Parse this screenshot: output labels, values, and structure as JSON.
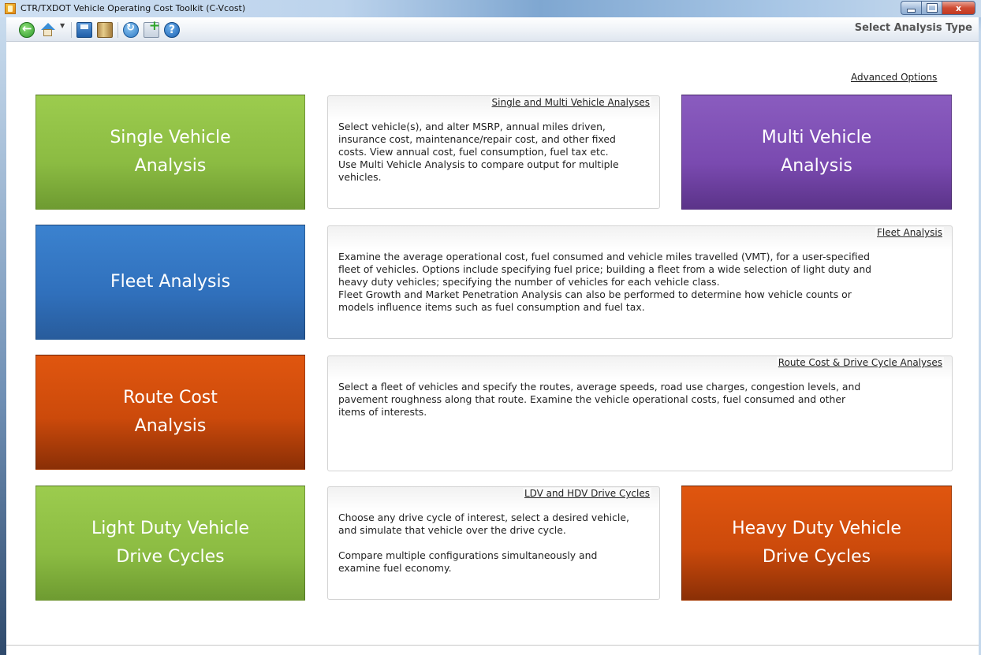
{
  "window": {
    "title": "CTR/TXDOT Vehicle Operating Cost Toolkit (C-Vcost)",
    "caption_close": "x"
  },
  "toolbar": {
    "icons": [
      "back-icon",
      "home-icon",
      "save-icon",
      "book-icon",
      "refresh-icon",
      "add-file-icon",
      "help-icon"
    ],
    "help_glyph": "?",
    "page_title": "Select Analysis Type"
  },
  "advanced_options_label": "Advanced Options",
  "tiles": {
    "single_vehicle": "Single Vehicle\nAnalysis",
    "multi_vehicle": "Multi Vehicle\nAnalysis",
    "fleet": "Fleet Analysis",
    "route_cost": "Route Cost\nAnalysis",
    "ldv_cycles": "Light Duty Vehicle\nDrive Cycles",
    "hdv_cycles": "Heavy Duty Vehicle\nDrive Cycles"
  },
  "descriptions": {
    "single_multi": {
      "heading": "Single and Multi Vehicle Analyses",
      "text": "Select vehicle(s), and alter MSRP, annual miles driven,\ninsurance cost, maintenance/repair cost, and other fixed\ncosts. View annual cost, fuel consumption, fuel tax etc.\nUse Multi Vehicle Analysis to compare output for multiple\nvehicles."
    },
    "fleet": {
      "heading": "Fleet Analysis",
      "text": "Examine the average operational cost, fuel consumed and vehicle miles travelled (VMT), for a user-specified\nfleet of vehicles. Options include specifying fuel price; building a fleet from a wide selection of light duty and\nheavy duty vehicles; specifying the number of vehicles for each vehicle class.\nFleet Growth and Market Penetration Analysis can also be performed to determine how vehicle counts or\nmodels influence items such as fuel consumption and fuel tax."
    },
    "route": {
      "heading": "Route Cost & Drive Cycle Analyses",
      "text": "Select a fleet of vehicles and specify the routes, average speeds, road use charges, congestion levels, and\npavement roughness along that route. Examine the vehicle operational costs, fuel consumed and other\nitems of interests."
    },
    "drive_cycles": {
      "heading": "LDV and HDV Drive Cycles",
      "text": "Choose any drive cycle of interest, select a desired vehicle,\nand simulate that vehicle over the drive cycle.\n\nCompare multiple configurations simultaneously and\nexamine fuel economy."
    }
  },
  "colors": {
    "green": "#8bbb42",
    "purple": "#7a4ab0",
    "blue": "#3070bc",
    "orange": "#cc4a0b"
  }
}
